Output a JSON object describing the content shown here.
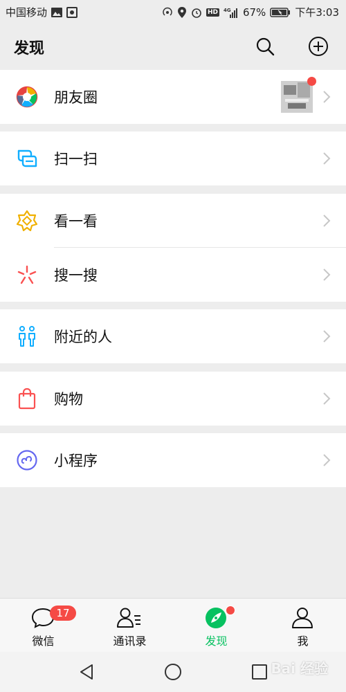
{
  "status_bar": {
    "carrier": "中国移动",
    "network": "4G",
    "battery_percent": "67%",
    "time": "下午3:03",
    "hd_label": "HD"
  },
  "header": {
    "title": "发现",
    "search_icon": "search-icon",
    "add_icon": "plus-circle-icon"
  },
  "menu": {
    "moments": {
      "label": "朋友圈",
      "icon": "moments-aperture-icon"
    },
    "scan": {
      "label": "扫一扫",
      "icon": "scan-icon"
    },
    "top_stories": {
      "label": "看一看",
      "icon": "top-stories-icon"
    },
    "search": {
      "label": "搜一搜",
      "icon": "search-spark-icon"
    },
    "nearby": {
      "label": "附近的人",
      "icon": "people-nearby-icon"
    },
    "shopping": {
      "label": "购物",
      "icon": "shopping-bag-icon"
    },
    "mini_programs": {
      "label": "小程序",
      "icon": "mini-program-icon"
    }
  },
  "tabbar": {
    "chats": {
      "label": "微信",
      "badge": "17"
    },
    "contacts": {
      "label": "通讯录"
    },
    "discover": {
      "label": "发现"
    },
    "me": {
      "label": "我"
    }
  },
  "navbar": {
    "back": "back-icon",
    "home": "home-icon",
    "recents": "recents-icon"
  },
  "watermark": "Bai 经验",
  "colors": {
    "accent": "#07c160",
    "badge": "#f54a45",
    "background": "#ededed"
  }
}
